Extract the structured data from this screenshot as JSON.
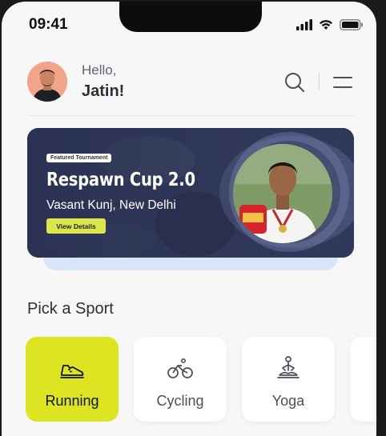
{
  "status_bar": {
    "time": "09:41"
  },
  "header": {
    "greeting": "Hello,",
    "user_name": "Jatin!"
  },
  "banner": {
    "tag": "Featured Tournament",
    "title": "Respawn Cup 2.0",
    "location": "Vasant Kunj, New Delhi",
    "cta": "View Details"
  },
  "sports_section": {
    "title": "Pick a Sport",
    "items": [
      {
        "label": "Running",
        "icon": "running-shoe-icon",
        "active": true
      },
      {
        "label": "Cycling",
        "icon": "bicycle-icon",
        "active": false
      },
      {
        "label": "Yoga",
        "icon": "yoga-icon",
        "active": false
      },
      {
        "label": "",
        "icon": "more",
        "active": false
      }
    ]
  },
  "colors": {
    "accent": "#DDE421",
    "banner_bg": "#2C3354",
    "background": "#F7F7F8"
  }
}
